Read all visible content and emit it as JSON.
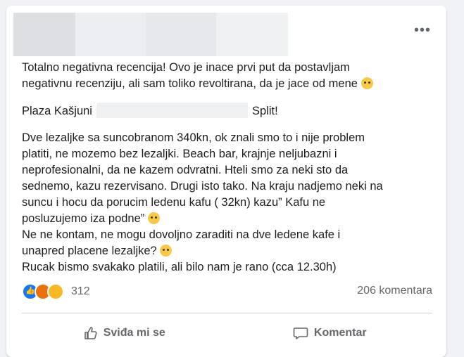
{
  "post": {
    "paragraphs": {
      "p1_line1": "Totalno negativna recencija! Ovo je inace prvi put da postavljam",
      "p1_line2": "negativnu recenziju, ali sam toliko revoltirana, da je jace od mene",
      "p2_start": "Plaza Kašjuni",
      "p2_end": "Split!",
      "p3_l1": "Dve lezaljke sa suncobranom 340kn, ok znali smo to i nije problem",
      "p3_l2": "platiti, ne mozemo bez lezaljki. Beach bar, krajnje neljubazni i",
      "p3_l3": "neprofesionalni, da ne kazem odvratni. Hteli smo za neki sto da",
      "p3_l4": "sednemo, kazu rezervisano. Drugi isto tako. Na kraju nadjemo neki na",
      "p3_l5": "suncu i hocu da porucim ledenu kafu ( 32kn) kazu” Kafu ne",
      "p3_l6": "posluzujemo iza podne”",
      "p3_l7": "Ne ne kontam, ne mogu dovoljno zaraditi na dve ledene kafe i",
      "p3_l8": "unapred placene lezaljke?",
      "p3_l9": "Rucak bismo svakako platili, ali bilo nam je rano (cca 12.30h)"
    },
    "reactions_count": "312",
    "comments_count": "206 komentara",
    "like_label": "Sviđa mi se",
    "comment_label": "Komentar",
    "menu_glyph": "•••"
  },
  "icons": {
    "menu": "more-dots-icon",
    "like": "thumbs-up-icon",
    "comment": "comment-bubble-icon"
  },
  "colors": {
    "like_blue": "#1877f2",
    "angry": "#e9710f",
    "sad": "#f7b928",
    "muted_text": "#65676b"
  }
}
